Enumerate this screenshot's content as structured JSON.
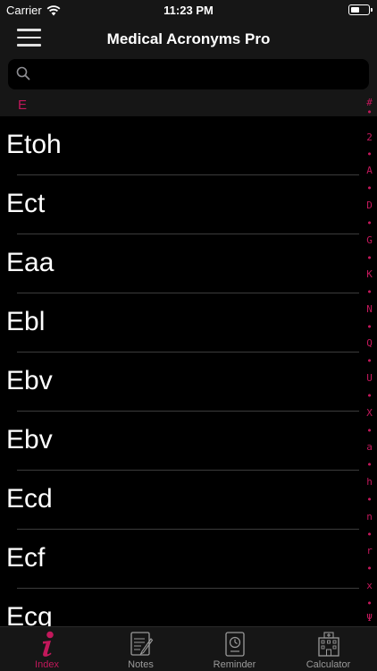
{
  "status_bar": {
    "carrier": "Carrier",
    "time": "11:23 PM"
  },
  "nav": {
    "title": "Medical Acronyms Pro"
  },
  "search": {
    "placeholder": ""
  },
  "section": {
    "header": "E"
  },
  "list": {
    "items": [
      "Etoh",
      "Ect",
      "Eaa",
      "Ebl",
      "Ebv",
      "Ebv",
      "Ecd",
      "Ecf",
      "Ecg"
    ]
  },
  "index_letters": [
    "#",
    "2",
    "A",
    "D",
    "G",
    "K",
    "N",
    "Q",
    "U",
    "X",
    "a",
    "h",
    "n",
    "r",
    "x",
    "Ψ"
  ],
  "tabs": [
    {
      "label": "Index",
      "icon": "info-icon",
      "active": true
    },
    {
      "label": "Notes",
      "icon": "notes-icon",
      "active": false
    },
    {
      "label": "Reminder",
      "icon": "reminder-icon",
      "active": false
    },
    {
      "label": "Calculator",
      "icon": "hospital-icon",
      "active": false
    }
  ],
  "colors": {
    "accent": "#c2185b",
    "background": "#000000",
    "bar": "#161616"
  }
}
